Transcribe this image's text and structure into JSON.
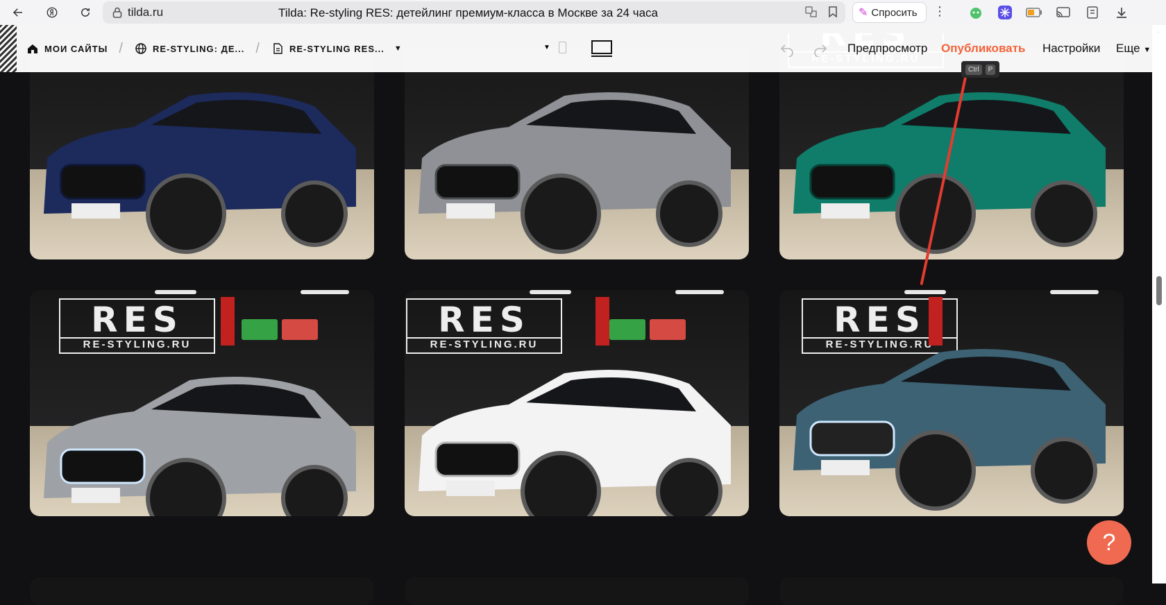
{
  "browser": {
    "domain": "tilda.ru",
    "page_title": "Tilda: Re-styling RES: детейлинг премиум-класса в Москве за 24 часа",
    "ask_label": "Спросить"
  },
  "editor": {
    "crumbs": [
      {
        "label": "МОИ САЙТЫ",
        "icon": "home-icon"
      },
      {
        "label": "RE-STYLING: ДЕ...",
        "icon": "globe-icon"
      },
      {
        "label": "RE-STYLING RES...",
        "icon": "page-icon"
      }
    ],
    "preview_label": "Предпросмотр",
    "publish_label": "Опубликовать",
    "settings_label": "Настройки",
    "more_label": "Еще",
    "tooltip_keys": [
      "Ctrl",
      "P"
    ]
  },
  "gallery": {
    "logo_big": "RES",
    "logo_small": "RE-STYLING.RU",
    "cars": [
      {
        "body": "#1c2a5c",
        "accent": "#0f1733",
        "kind": "suv",
        "logo": false
      },
      {
        "body": "#8f9196",
        "accent": "#4c4e52",
        "kind": "suv",
        "logo": false
      },
      {
        "body": "#0f7d6a",
        "accent": "#064034",
        "kind": "suv",
        "logo": true
      },
      {
        "body": "#9ea1a5",
        "accent": "#55585c",
        "kind": "sedan",
        "logo": true
      },
      {
        "body": "#f3f3f3",
        "accent": "#b7b7b7",
        "kind": "hatch",
        "logo": true
      },
      {
        "body": "#3d6273",
        "accent": "#1c3440",
        "kind": "suv",
        "logo": true
      }
    ]
  },
  "help_label": "?"
}
